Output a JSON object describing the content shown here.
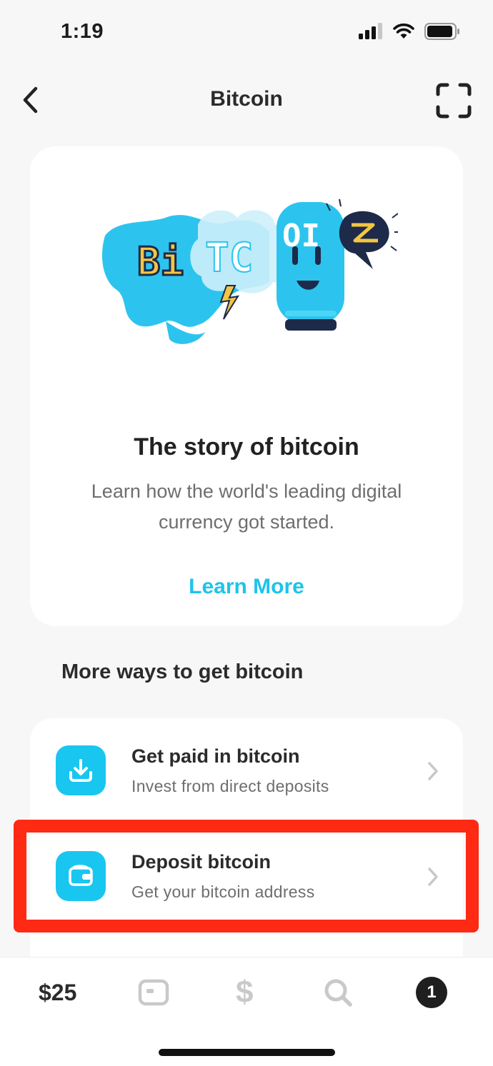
{
  "status_bar": {
    "time": "1:19"
  },
  "nav": {
    "title": "Bitcoin"
  },
  "story": {
    "title": "The story of bitcoin",
    "description": "Learn how the world's leading digital currency got started.",
    "link_label": "Learn More",
    "illustration_letters": "BiTCOIN"
  },
  "section": {
    "title": "More ways to get bitcoin"
  },
  "options": [
    {
      "title": "Get paid in bitcoin",
      "subtitle": "Invest from direct deposits",
      "icon": "download-icon"
    },
    {
      "title": "Deposit bitcoin",
      "subtitle": "Get your bitcoin address",
      "icon": "wallet-icon"
    }
  ],
  "tab_bar": {
    "balance": "$25",
    "dollar_symbol": "$",
    "activity_count": "1"
  },
  "colors": {
    "accent": "#1dc4ea",
    "icon_bg": "#19c6f0",
    "highlight": "#ff2a14",
    "background": "#f7f7f7"
  }
}
